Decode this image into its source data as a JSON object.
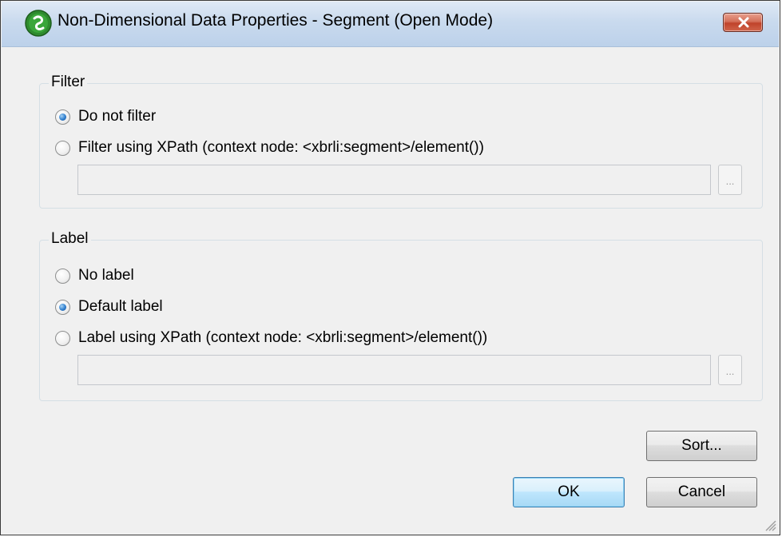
{
  "window": {
    "title": "Non-Dimensional Data Properties - Segment (Open Mode)",
    "app_icon": "altova-app-icon",
    "close_icon": "close-x-icon",
    "close_color": "#c0432b"
  },
  "filter": {
    "legend": "Filter",
    "options": [
      {
        "label": "Do not filter",
        "checked": true
      },
      {
        "label": "Filter using XPath (context node: <xbrli:segment>/element())",
        "checked": false
      }
    ],
    "xpath_value": "",
    "browse_label": "..."
  },
  "label_group": {
    "legend": "Label",
    "options": [
      {
        "label": "No label",
        "checked": false
      },
      {
        "label": "Default label",
        "checked": true
      },
      {
        "label": "Label using XPath (context node: <xbrli:segment>/element())",
        "checked": false
      }
    ],
    "xpath_value": "",
    "browse_label": "..."
  },
  "buttons": {
    "sort": "Sort...",
    "ok": "OK",
    "cancel": "Cancel"
  }
}
